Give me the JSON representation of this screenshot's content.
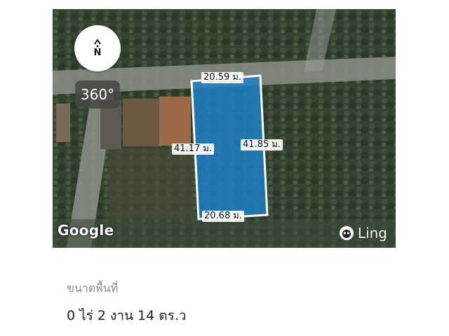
{
  "map": {
    "compass_label": "N",
    "rotation_label": "360°",
    "attribution": "Google",
    "brand": "Ling",
    "plot_outline_color": "#ffffff",
    "plot_fill_color": "#1f7fc4",
    "measurements": {
      "top": "20.59 ม.",
      "left": "41.17 ม.",
      "right": "41.85 ม.",
      "bottom": "20.68 ม."
    }
  },
  "area": {
    "label": "ขนาดพื้นที่",
    "value": "0 ไร่ 2 งาน 14 ตร.ว"
  }
}
